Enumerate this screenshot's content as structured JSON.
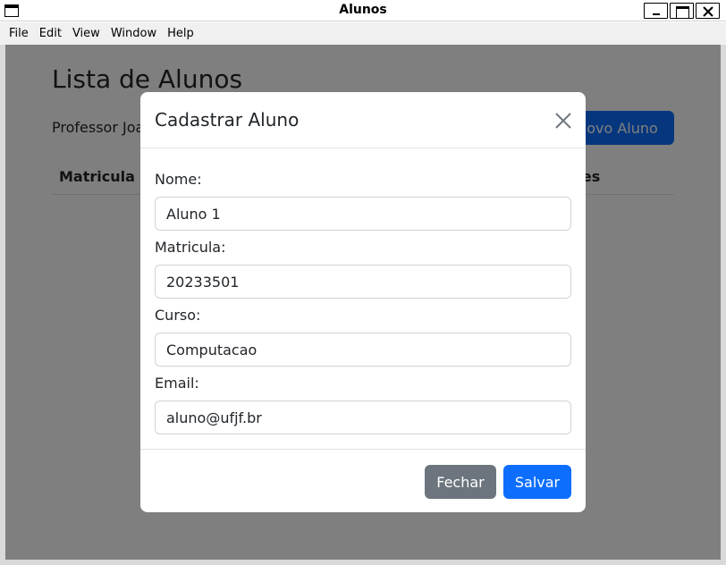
{
  "window": {
    "title": "Alunos"
  },
  "menu": [
    "File",
    "Edit",
    "View",
    "Window",
    "Help"
  ],
  "page": {
    "title": "Lista de Alunos",
    "professor_text": "Professor Joao",
    "new_button": "Novo Aluno",
    "table_headers": [
      "Matricula",
      "Ações"
    ]
  },
  "modal": {
    "title": "Cadastrar Aluno",
    "fields": [
      {
        "label": "Nome:",
        "value": "Aluno 1"
      },
      {
        "label": "Matricula:",
        "value": "20233501"
      },
      {
        "label": "Curso:",
        "value": "Computacao"
      },
      {
        "label": "Email:",
        "value": "aluno@ufjf.br"
      }
    ],
    "close_button": "Fechar",
    "save_button": "Salvar"
  },
  "colors": {
    "primary": "#0d6efd",
    "secondary": "#6c757d",
    "overlay": "rgba(0,0,0,0.5)"
  },
  "icons": [
    "window-icon",
    "minimize-icon",
    "maximize-icon",
    "close-icon",
    "modal-close-icon"
  ]
}
